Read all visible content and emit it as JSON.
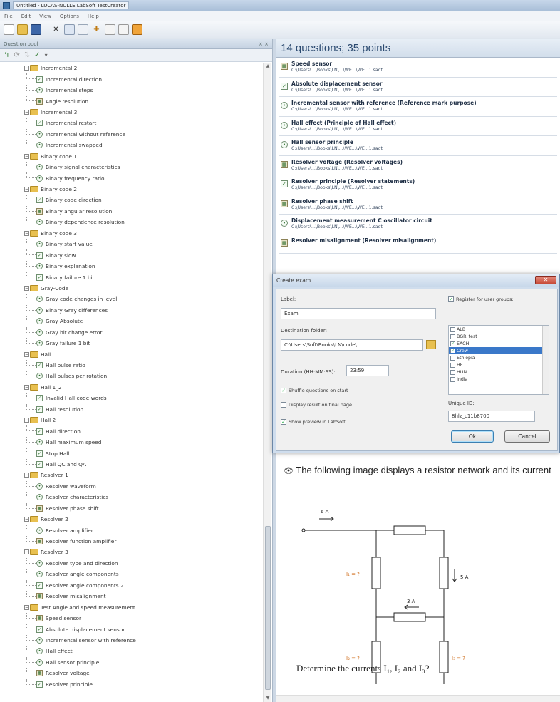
{
  "window": {
    "title": "Untitled - LUCAS-NULLE LabSoft TestCreator"
  },
  "menu": [
    "File",
    "Edit",
    "View",
    "Options",
    "Help"
  ],
  "left_pane": {
    "title": "Question pool",
    "close_glyph": "× ×"
  },
  "tree": [
    {
      "type": "folder",
      "label": "Incremental 2"
    },
    {
      "type": "leaf",
      "icon": "check",
      "label": "Incremental direction"
    },
    {
      "type": "leaf",
      "icon": "radio",
      "label": "Incremental steps"
    },
    {
      "type": "leaf",
      "icon": "grid",
      "label": "Angle resolution"
    },
    {
      "type": "folder",
      "label": "Incremental 3"
    },
    {
      "type": "leaf",
      "icon": "check",
      "label": "Incremental restart"
    },
    {
      "type": "leaf",
      "icon": "radio",
      "label": "Incremental without reference"
    },
    {
      "type": "leaf",
      "icon": "radio",
      "label": "Incremental swapped"
    },
    {
      "type": "folder",
      "label": "Binary code 1"
    },
    {
      "type": "leaf",
      "icon": "radio",
      "label": "Binary signal characteristics"
    },
    {
      "type": "leaf",
      "icon": "radio",
      "label": "Binary frequency ratio"
    },
    {
      "type": "folder",
      "label": "Binary code 2"
    },
    {
      "type": "leaf",
      "icon": "check",
      "label": "Binary code direction"
    },
    {
      "type": "leaf",
      "icon": "grid",
      "label": "Binary angular resolution"
    },
    {
      "type": "leaf",
      "icon": "radio",
      "label": "Binary dependence resolution"
    },
    {
      "type": "folder",
      "label": "Binary code 3"
    },
    {
      "type": "leaf",
      "icon": "radio",
      "label": "Binary start value"
    },
    {
      "type": "leaf",
      "icon": "check",
      "label": "Binary slow"
    },
    {
      "type": "leaf",
      "icon": "radio",
      "label": "Binary explanation"
    },
    {
      "type": "leaf",
      "icon": "check",
      "label": "Binary failure 1 bit"
    },
    {
      "type": "folder",
      "label": "Gray-Code"
    },
    {
      "type": "leaf",
      "icon": "radio",
      "label": "Gray code changes in level"
    },
    {
      "type": "leaf",
      "icon": "radio",
      "label": "Binary Gray differences"
    },
    {
      "type": "leaf",
      "icon": "radio",
      "label": "Gray Absolute"
    },
    {
      "type": "leaf",
      "icon": "radio",
      "label": "Gray bit change error"
    },
    {
      "type": "leaf",
      "icon": "radio",
      "label": "Gray failure 1 bit"
    },
    {
      "type": "folder",
      "label": "Hall"
    },
    {
      "type": "leaf",
      "icon": "check",
      "label": "Hall pulse ratio"
    },
    {
      "type": "leaf",
      "icon": "radio",
      "label": "Hall pulses per rotation"
    },
    {
      "type": "folder",
      "label": "Hall 1_2"
    },
    {
      "type": "leaf",
      "icon": "check",
      "label": "Invalid Hall code words"
    },
    {
      "type": "leaf",
      "icon": "check",
      "label": "Hall resolution"
    },
    {
      "type": "folder",
      "label": "Hall 2"
    },
    {
      "type": "leaf",
      "icon": "check",
      "label": "Hall direction"
    },
    {
      "type": "leaf",
      "icon": "radio",
      "label": "Hall maximum speed"
    },
    {
      "type": "leaf",
      "icon": "check",
      "label": "Stop Hall"
    },
    {
      "type": "leaf",
      "icon": "check",
      "label": "Hall QC and QA"
    },
    {
      "type": "folder",
      "label": "Resolver 1"
    },
    {
      "type": "leaf",
      "icon": "radio",
      "label": "Resolver waveform"
    },
    {
      "type": "leaf",
      "icon": "radio",
      "label": "Resolver characteristics"
    },
    {
      "type": "leaf",
      "icon": "grid",
      "label": "Resolver phase shift"
    },
    {
      "type": "folder",
      "label": "Resolver 2"
    },
    {
      "type": "leaf",
      "icon": "radio",
      "label": "Resolver amplifier"
    },
    {
      "type": "leaf",
      "icon": "grid",
      "label": "Resolver function amplifier"
    },
    {
      "type": "folder",
      "label": "Resolver 3"
    },
    {
      "type": "leaf",
      "icon": "radio",
      "label": "Resolver type and direction"
    },
    {
      "type": "leaf",
      "icon": "radio",
      "label": "Resolver angle components"
    },
    {
      "type": "leaf",
      "icon": "check",
      "label": "Resolver angle components 2"
    },
    {
      "type": "leaf",
      "icon": "grid",
      "label": "Resolver misalignment"
    },
    {
      "type": "folder",
      "label": "Test Angle and speed measurement"
    },
    {
      "type": "leaf",
      "icon": "grid",
      "label": "Speed sensor"
    },
    {
      "type": "leaf",
      "icon": "check",
      "label": "Absolute displacement sensor"
    },
    {
      "type": "leaf",
      "icon": "radio",
      "label": "Incremental sensor with reference"
    },
    {
      "type": "leaf",
      "icon": "radio",
      "label": "Hall effect"
    },
    {
      "type": "leaf",
      "icon": "radio",
      "label": "Hall sensor principle"
    },
    {
      "type": "leaf",
      "icon": "grid",
      "label": "Resolver voltage"
    },
    {
      "type": "leaf",
      "icon": "check",
      "label": "Resolver principle"
    }
  ],
  "right_pane": {
    "header": "14 questions; 35 points",
    "questions": [
      {
        "icon": "grid",
        "title": "Speed sensor",
        "path": "C:\\Users\\...\\Books\\LN\\...\\WE...\\WE...1.sadt"
      },
      {
        "icon": "check",
        "title": "Absolute displacement sensor",
        "path": "C:\\Users\\...\\Books\\LN\\...\\WE...\\WE...1.sadt"
      },
      {
        "icon": "radio",
        "title": "Incremental sensor with reference (Reference mark purpose)",
        "path": "C:\\Users\\...\\Books\\LN\\...\\WE...\\WE...1.sadt"
      },
      {
        "icon": "radio",
        "title": "Hall effect (Principle of Hall effect)",
        "path": "C:\\Users\\...\\Books\\LN\\...\\WE...\\WE...1.sadt"
      },
      {
        "icon": "radio",
        "title": "Hall sensor principle",
        "path": "C:\\Users\\...\\Books\\LN\\...\\WE...\\WE...1.sadt"
      },
      {
        "icon": "grid",
        "title": "Resolver voltage (Resolver voltages)",
        "path": "C:\\Users\\...\\Books\\LN\\...\\WE...\\WE...1.sadt"
      },
      {
        "icon": "check",
        "title": "Resolver principle (Resolver statements)",
        "path": "C:\\Users\\...\\Books\\LN\\...\\WE...\\WE...1.sadt"
      },
      {
        "icon": "grid",
        "title": "Resolver phase shift",
        "path": "C:\\Users\\...\\Books\\LN\\...\\WE...\\WE...1.sadt"
      },
      {
        "icon": "radio",
        "title": "Displacement measurement C oscillator circuit",
        "path": "C:\\Users\\...\\Books\\LN\\...\\WE...\\WE...1.sadt"
      },
      {
        "icon": "grid",
        "title": "Resolver misalignment (Resolver misalignment)",
        "path": ""
      }
    ],
    "question_text": "The following image displays a resistor network and its current",
    "determine_text": "Determine the currents I₁, I₂ and I₃?",
    "circuit": {
      "label_6a": "6 A",
      "label_5a_right": "5 A",
      "label_3a": "3 A",
      "label_i1": "I₁ = ?",
      "label_i2": "I₂ = ?",
      "label_i3": "I₃ = ?"
    }
  },
  "dialog": {
    "title": "Create exam",
    "close": "✕",
    "label_caption": "Label:",
    "label_value": "Exam",
    "dest_caption": "Destination folder:",
    "dest_value": "C:\\Users\\Soft\\Books\\LN\\code\\",
    "duration_caption": "Duration (HH:MM:SS):",
    "duration_value": "23:59",
    "shuffle": {
      "label": "Shuffle questions on start",
      "checked": true
    },
    "display_result": {
      "label": "Display result on final page",
      "checked": false
    },
    "show_preview": {
      "label": "Show preview in LabSoft",
      "checked": true
    },
    "register": {
      "label": "Register for user groups:",
      "checked": true
    },
    "groups": [
      {
        "name": "ALB",
        "checked": false
      },
      {
        "name": "BGR_test",
        "checked": false
      },
      {
        "name": "EACH",
        "checked": true
      },
      {
        "name": "Crew",
        "checked": true,
        "selected": true
      },
      {
        "name": "Ethiopia",
        "checked": false
      },
      {
        "name": "HF",
        "checked": false
      },
      {
        "name": "HUN",
        "checked": false
      },
      {
        "name": "India",
        "checked": false
      }
    ],
    "unique_caption": "Unique ID:",
    "unique_value": "8hlz_c11b8700",
    "ok": "Ok",
    "cancel": "Cancel"
  }
}
